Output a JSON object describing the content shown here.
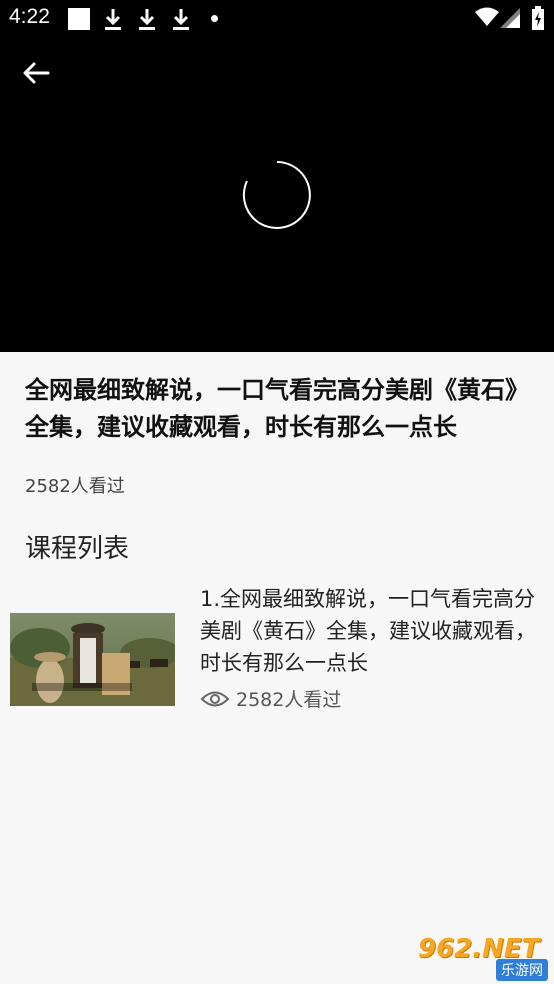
{
  "status_bar": {
    "time": "4:22"
  },
  "video": {
    "title": "全网最细致解说，一口气看完高分美剧《黄石》全集，建议收藏观看，时长有那么一点长",
    "view_count": "2582人看过"
  },
  "course_list": {
    "heading": "课程列表",
    "items": [
      {
        "title": "1.全网最细致解说，一口气看完高分美剧《黄石》全集，建议收藏观看，时长有那么一点长",
        "views": "2582人看过"
      }
    ]
  },
  "watermark": {
    "logo_text": "962.NET",
    "site_name": "乐游网"
  },
  "colors": {
    "background": "#f7f7f7",
    "video_bg": "#000000",
    "watermark_orange": "#f6a623",
    "watermark_blue": "#2f7fd8"
  }
}
